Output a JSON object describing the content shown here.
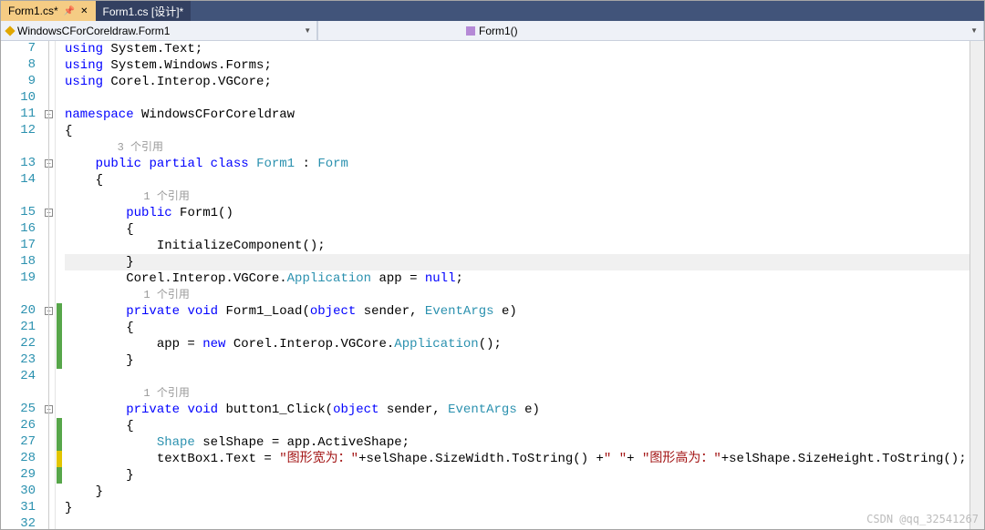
{
  "tabs": [
    {
      "label": "Form1.cs*",
      "active": true,
      "pinned": true,
      "closable": true
    },
    {
      "label": "Form1.cs [设计]*",
      "active": false,
      "pinned": false,
      "closable": false
    }
  ],
  "navbar": {
    "left": "WindowsCForCoreldraw.Form1",
    "right": "Form1()"
  },
  "watermark": "CSDN @qq_32541267",
  "lines": [
    {
      "n": 7,
      "code": [
        [
          "kw",
          "using"
        ],
        [
          "pl",
          " System.Text;"
        ]
      ]
    },
    {
      "n": 8,
      "code": [
        [
          "kw",
          "using"
        ],
        [
          "pl",
          " System.Windows.Forms;"
        ]
      ]
    },
    {
      "n": 9,
      "code": [
        [
          "kw",
          "using"
        ],
        [
          "pl",
          " Corel.Interop.VGCore;"
        ]
      ]
    },
    {
      "n": 10,
      "code": [
        [
          "pl",
          ""
        ]
      ]
    },
    {
      "n": 11,
      "fold": "-",
      "code": [
        [
          "kw",
          "namespace"
        ],
        [
          "pl",
          " WindowsCForCoreldraw"
        ]
      ]
    },
    {
      "n": 12,
      "code": [
        [
          "pl",
          "{"
        ]
      ]
    },
    {
      "n": null,
      "ref": "3 个引用",
      "indent": 2
    },
    {
      "n": 13,
      "fold": "-",
      "code": [
        [
          "pl",
          "    "
        ],
        [
          "kw",
          "public"
        ],
        [
          "pl",
          " "
        ],
        [
          "kw",
          "partial"
        ],
        [
          "pl",
          " "
        ],
        [
          "kw",
          "class"
        ],
        [
          "pl",
          " "
        ],
        [
          "ty",
          "Form1"
        ],
        [
          "pl",
          " : "
        ],
        [
          "ty",
          "Form"
        ]
      ]
    },
    {
      "n": 14,
      "code": [
        [
          "pl",
          "    {"
        ]
      ]
    },
    {
      "n": null,
      "ref": "1 个引用",
      "indent": 3
    },
    {
      "n": 15,
      "fold": "-",
      "code": [
        [
          "pl",
          "        "
        ],
        [
          "kw",
          "public"
        ],
        [
          "pl",
          " Form1()"
        ]
      ]
    },
    {
      "n": 16,
      "code": [
        [
          "pl",
          "        {"
        ]
      ]
    },
    {
      "n": 17,
      "code": [
        [
          "pl",
          "            InitializeComponent();"
        ]
      ]
    },
    {
      "n": 18,
      "current": true,
      "code": [
        [
          "pl",
          "        }"
        ]
      ]
    },
    {
      "n": 19,
      "code": [
        [
          "pl",
          "        Corel.Interop.VGCore."
        ],
        [
          "ty",
          "Application"
        ],
        [
          "pl",
          " app = "
        ],
        [
          "kw",
          "null"
        ],
        [
          "pl",
          ";"
        ]
      ]
    },
    {
      "n": null,
      "ref": "1 个引用",
      "indent": 3
    },
    {
      "n": 20,
      "fold": "-",
      "chg": "green",
      "code": [
        [
          "pl",
          "        "
        ],
        [
          "kw",
          "private"
        ],
        [
          "pl",
          " "
        ],
        [
          "kw",
          "void"
        ],
        [
          "pl",
          " Form1_Load("
        ],
        [
          "kw",
          "object"
        ],
        [
          "pl",
          " sender, "
        ],
        [
          "ty",
          "EventArgs"
        ],
        [
          "pl",
          " e)"
        ]
      ]
    },
    {
      "n": 21,
      "chg": "green",
      "code": [
        [
          "pl",
          "        {"
        ]
      ]
    },
    {
      "n": 22,
      "chg": "green",
      "code": [
        [
          "pl",
          "            app = "
        ],
        [
          "kw",
          "new"
        ],
        [
          "pl",
          " Corel.Interop.VGCore."
        ],
        [
          "ty",
          "Application"
        ],
        [
          "pl",
          "();"
        ]
      ]
    },
    {
      "n": 23,
      "chg": "green",
      "code": [
        [
          "pl",
          "        }"
        ]
      ]
    },
    {
      "n": 24,
      "code": [
        [
          "pl",
          ""
        ]
      ]
    },
    {
      "n": null,
      "ref": "1 个引用",
      "indent": 3
    },
    {
      "n": 25,
      "fold": "-",
      "code": [
        [
          "pl",
          "        "
        ],
        [
          "kw",
          "private"
        ],
        [
          "pl",
          " "
        ],
        [
          "kw",
          "void"
        ],
        [
          "pl",
          " button1_Click("
        ],
        [
          "kw",
          "object"
        ],
        [
          "pl",
          " sender, "
        ],
        [
          "ty",
          "EventArgs"
        ],
        [
          "pl",
          " e)"
        ]
      ]
    },
    {
      "n": 26,
      "chg": "green",
      "code": [
        [
          "pl",
          "        {"
        ]
      ]
    },
    {
      "n": 27,
      "chg": "green",
      "code": [
        [
          "pl",
          "            "
        ],
        [
          "ty",
          "Shape"
        ],
        [
          "pl",
          " selShape = app.ActiveShape;"
        ]
      ]
    },
    {
      "n": 28,
      "chg": "yellow",
      "code": [
        [
          "pl",
          "            textBox1.Text = "
        ],
        [
          "st",
          "\"图形宽为：\""
        ],
        [
          "pl",
          "+selShape.SizeWidth.ToString() +"
        ],
        [
          "st",
          "\" \""
        ],
        [
          "pl",
          "+ "
        ],
        [
          "st",
          "\"图形高为：\""
        ],
        [
          "pl",
          "+selShape.SizeHeight.ToString();"
        ]
      ]
    },
    {
      "n": 29,
      "chg": "green",
      "code": [
        [
          "pl",
          "        }"
        ]
      ]
    },
    {
      "n": 30,
      "code": [
        [
          "pl",
          "    }"
        ]
      ]
    },
    {
      "n": 31,
      "code": [
        [
          "pl",
          "}"
        ]
      ]
    },
    {
      "n": 32,
      "code": [
        [
          "pl",
          ""
        ]
      ]
    }
  ]
}
